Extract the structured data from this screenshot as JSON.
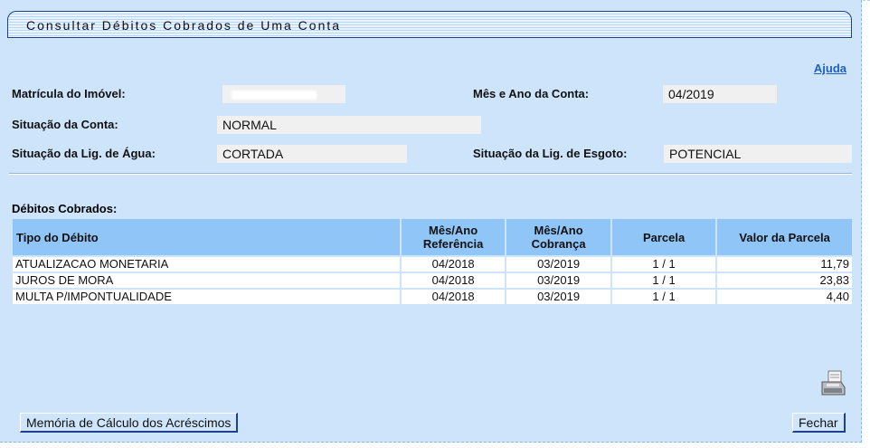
{
  "window": {
    "title": "Consultar Débitos Cobrados de Uma Conta",
    "help_link": "Ajuda"
  },
  "account": {
    "matricula_label": "Matrícula do Imóvel:",
    "matricula_value": "",
    "mes_ano_label": "Mês e Ano da Conta:",
    "mes_ano_value": "04/2019",
    "situacao_conta_label": "Situação da Conta:",
    "situacao_conta_value": "NORMAL",
    "lig_agua_label": "Situação da Lig. de Água:",
    "lig_agua_value": "CORTADA",
    "lig_esgoto_label": "Situação da Lig. de Esgoto:",
    "lig_esgoto_value": "POTENCIAL"
  },
  "debits": {
    "section_title": "Débitos Cobrados:",
    "headers": {
      "tipo": "Tipo do Débito",
      "ref_line1": "Mês/Ano",
      "ref_line2": "Referência",
      "cob_line1": "Mês/Ano",
      "cob_line2": "Cobrança",
      "parcela": "Parcela",
      "valor": "Valor da Parcela"
    },
    "rows": [
      {
        "tipo": "ATUALIZACAO MONETARIA",
        "referencia": "04/2018",
        "cobranca": "03/2019",
        "parcela": "1 / 1",
        "valor": "11,79"
      },
      {
        "tipo": "JUROS DE MORA",
        "referencia": "04/2018",
        "cobranca": "03/2019",
        "parcela": "1 / 1",
        "valor": "23,83"
      },
      {
        "tipo": "MULTA P/IMPONTUALIDADE",
        "referencia": "04/2018",
        "cobranca": "03/2019",
        "parcela": "1 / 1",
        "valor": "4,40"
      }
    ]
  },
  "footer": {
    "memoria_button": "Memória de Cálculo dos Acréscimos",
    "fechar_button": "Fechar",
    "printer_icon": "printer-icon"
  },
  "colors": {
    "background": "#cde4fb",
    "header_cell": "#90c5f8",
    "link": "#1f5fbf",
    "border": "#1f3f8f"
  }
}
